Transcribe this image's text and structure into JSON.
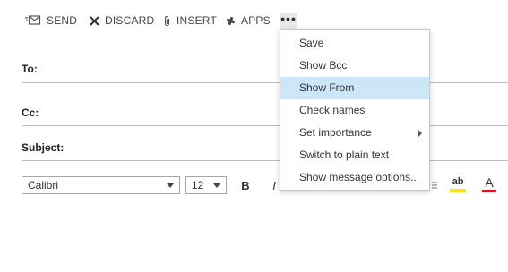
{
  "toolbar": {
    "send_label": "SEND",
    "discard_label": "DISCARD",
    "insert_label": "INSERT",
    "apps_label": "APPS",
    "more_label": "•••",
    "send_icon": "send-envelope-icon",
    "discard_icon": "x-icon",
    "insert_icon": "paperclip-icon",
    "apps_icon": "apps-icon"
  },
  "fields": {
    "to_label": "To:",
    "cc_label": "Cc:",
    "subject_label": "Subject:"
  },
  "format": {
    "font_value": "Calibri",
    "size_value": "12",
    "bold_label": "B",
    "italic_label": "I",
    "highlight_label": "ab",
    "font_color_label": "A",
    "highlight_color": "#ffe500",
    "font_color": "#e81123"
  },
  "menu": {
    "items": [
      {
        "label": "Save"
      },
      {
        "label": "Show Bcc"
      },
      {
        "label": "Show From"
      },
      {
        "label": "Check names"
      },
      {
        "label": "Set importance"
      },
      {
        "label": "Switch to plain text"
      },
      {
        "label": "Show message options..."
      }
    ],
    "highlight_color": "#cde6f7"
  }
}
